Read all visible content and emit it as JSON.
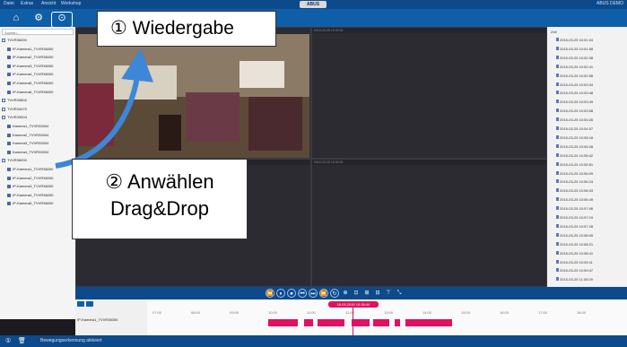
{
  "menu": [
    "Datei",
    "Extras",
    "Ansicht",
    "Workshop"
  ],
  "brand": "ABUS",
  "top_right": "ABUS DEMO",
  "toolbar": {
    "home_icon": "home-icon",
    "settings_icon": "gear-icon",
    "playback_icon": "playback-icon"
  },
  "search": {
    "placeholder": "Suchen..."
  },
  "tree": [
    {
      "label": "TVVR36000",
      "type": "group"
    },
    {
      "label": "IP-Kamera1_TVVR36000",
      "type": "cam"
    },
    {
      "label": "IP-Kamera2_TVVR36000",
      "type": "cam"
    },
    {
      "label": "IP-Kamera3_TVVR36000",
      "type": "cam"
    },
    {
      "label": "IP-Kamera4_TVVR36000",
      "type": "cam"
    },
    {
      "label": "IP-Kamera5_TVVR36000",
      "type": "cam"
    },
    {
      "label": "IP-Kamera6_TVVR36000",
      "type": "cam"
    },
    {
      "label": "TVVR33602",
      "type": "group"
    },
    {
      "label": "TVVR33470",
      "type": "group"
    },
    {
      "label": "TVVR33004",
      "type": "group"
    },
    {
      "label": "Kamera1_TVVR33004",
      "type": "cam"
    },
    {
      "label": "Kamera2_TVVR33004",
      "type": "cam"
    },
    {
      "label": "Kamera3_TVVR33004",
      "type": "cam"
    },
    {
      "label": "Kamera4_TVVR33004",
      "type": "cam"
    },
    {
      "label": "TVVR36000",
      "type": "group"
    },
    {
      "label": "IP-Kamera1_TVVR36000",
      "type": "cam"
    },
    {
      "label": "IP-Kamera2_TVVR36000",
      "type": "cam"
    },
    {
      "label": "IP-Kamera3_TVVR36000",
      "type": "cam"
    },
    {
      "label": "IP-Kamera4_TVVR36000",
      "type": "cam"
    },
    {
      "label": "IP-Kamera5_TVVR36000",
      "type": "cam"
    }
  ],
  "tiles": [
    {
      "header": ""
    },
    {
      "header": "2015-03-25 10:30:00"
    },
    {
      "header": "2015-03-25 10:30:00"
    },
    {
      "header": "2015-03-25 10:30:00"
    }
  ],
  "events_header": "Zeit",
  "events": [
    "2015-03-25 10:51:04",
    "2015-03-25 10:51:58",
    "2015-03-25 10:52:38",
    "2015-03-25 10:52:41",
    "2015-03-25 10:52:58",
    "2015-03-25 10:53:34",
    "2015-03-25 10:53:48",
    "2015-03-25 10:53:49",
    "2015-03-25 10:53:58",
    "2015-03-25 10:54:26",
    "2015-03-25 10:54:57",
    "2015-03-25 10:55:18",
    "2015-03-25 10:55:28",
    "2015-03-25 10:55:42",
    "2015-03-25 10:55:51",
    "2015-03-25 10:56:09",
    "2015-03-25 10:56:24",
    "2015-03-25 10:56:33",
    "2015-03-25 10:56:49",
    "2015-03-25 10:57:06",
    "2015-03-25 10:57:19",
    "2015-03-25 10:57:28",
    "2015-03-25 10:58:05",
    "2015-03-25 10:58:21",
    "2015-03-25 10:58:41",
    "2015-03-25 10:59:11",
    "2015-03-25 10:59:47",
    "2015-03-25 11:00:09"
  ],
  "controls": [
    "⏪",
    "⏸",
    "⏹",
    "⏮",
    "⏭",
    "⏩",
    "↻",
    "⊕",
    "⊡",
    "⊞",
    "⊟",
    "⊤",
    "⤡"
  ],
  "timeline": {
    "row_label": "IP-Kamera1_TVVR36000",
    "current_time": "16.03.2015 10:38:44",
    "ticks": [
      "07:00",
      "08:00",
      "09:00",
      "10:00",
      "11:00",
      "12:00",
      "13:00",
      "14:00",
      "15:00",
      "16:00",
      "17:00",
      "18:00"
    ],
    "date_labels": [
      "16.03.15",
      "16.03.15",
      "16.03.15",
      "16.03.15",
      "16.03.15"
    ]
  },
  "status": {
    "text": "Bewegungserkennung aktiviert"
  },
  "callouts": {
    "one": "① Wiedergabe",
    "two_line1": "② Anwählen",
    "two_line2": "Drag&Drop"
  },
  "colors": {
    "primary": "#0c4a8c",
    "toolbar": "#0f5fa8",
    "accent": "#e0115f",
    "arrow": "#3d86d8"
  }
}
